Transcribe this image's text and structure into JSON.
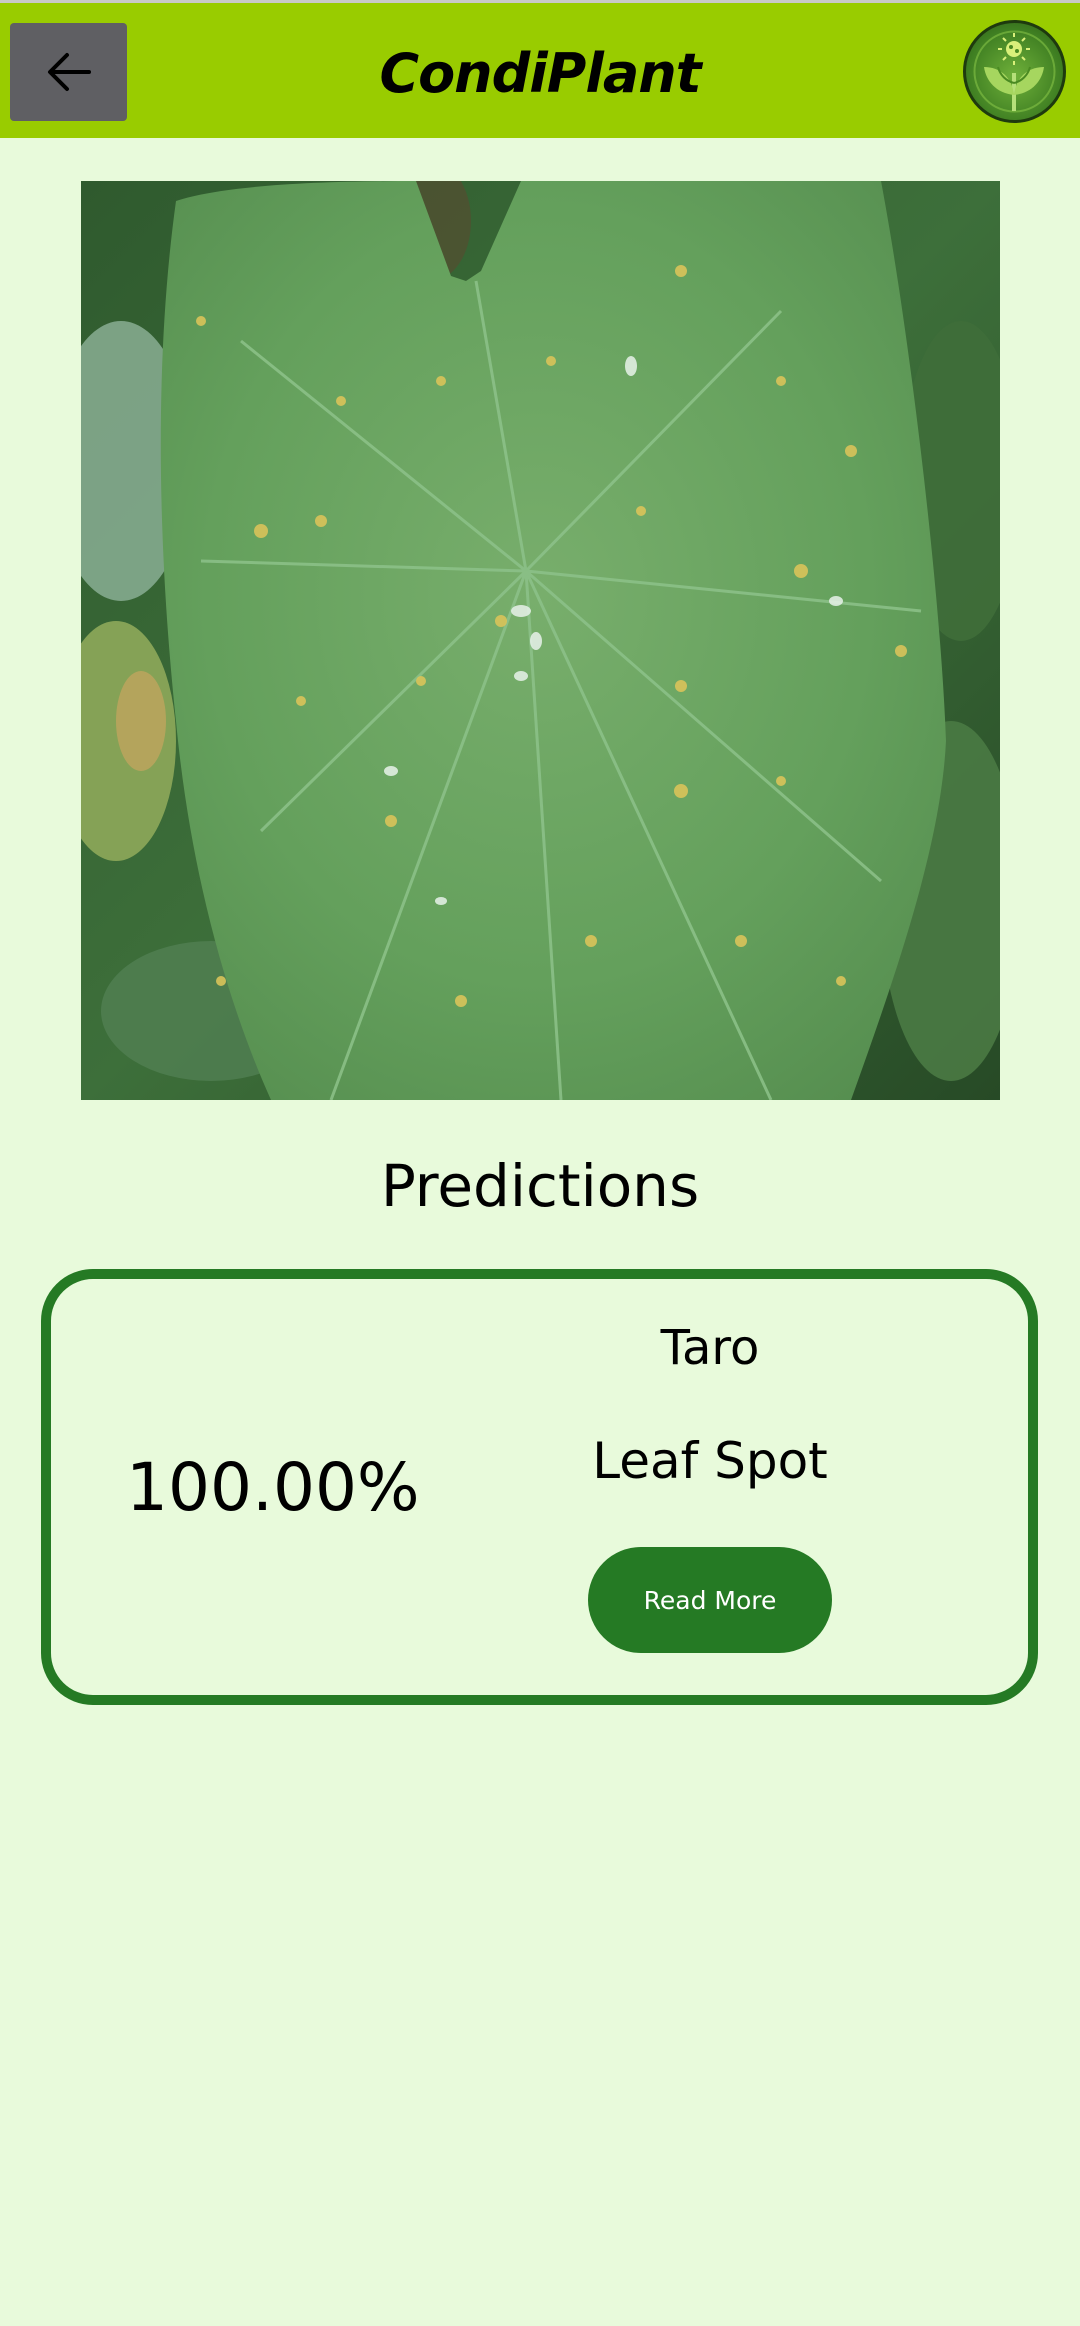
{
  "header": {
    "title": "CondiPlant",
    "back_icon": "arrow-left-icon",
    "logo_icon": "plant-virus-logo"
  },
  "photo": {
    "subject": "taro-leaf-photo"
  },
  "predictions": {
    "heading": "Predictions",
    "confidence": "100.00%",
    "plant": "Taro",
    "disease": "Leaf Spot",
    "read_more_label": "Read More"
  },
  "colors": {
    "header_bg": "#99cc00",
    "page_bg": "#e8fadb",
    "accent_green": "#257a24",
    "back_button_bg": "#5f5f63"
  }
}
